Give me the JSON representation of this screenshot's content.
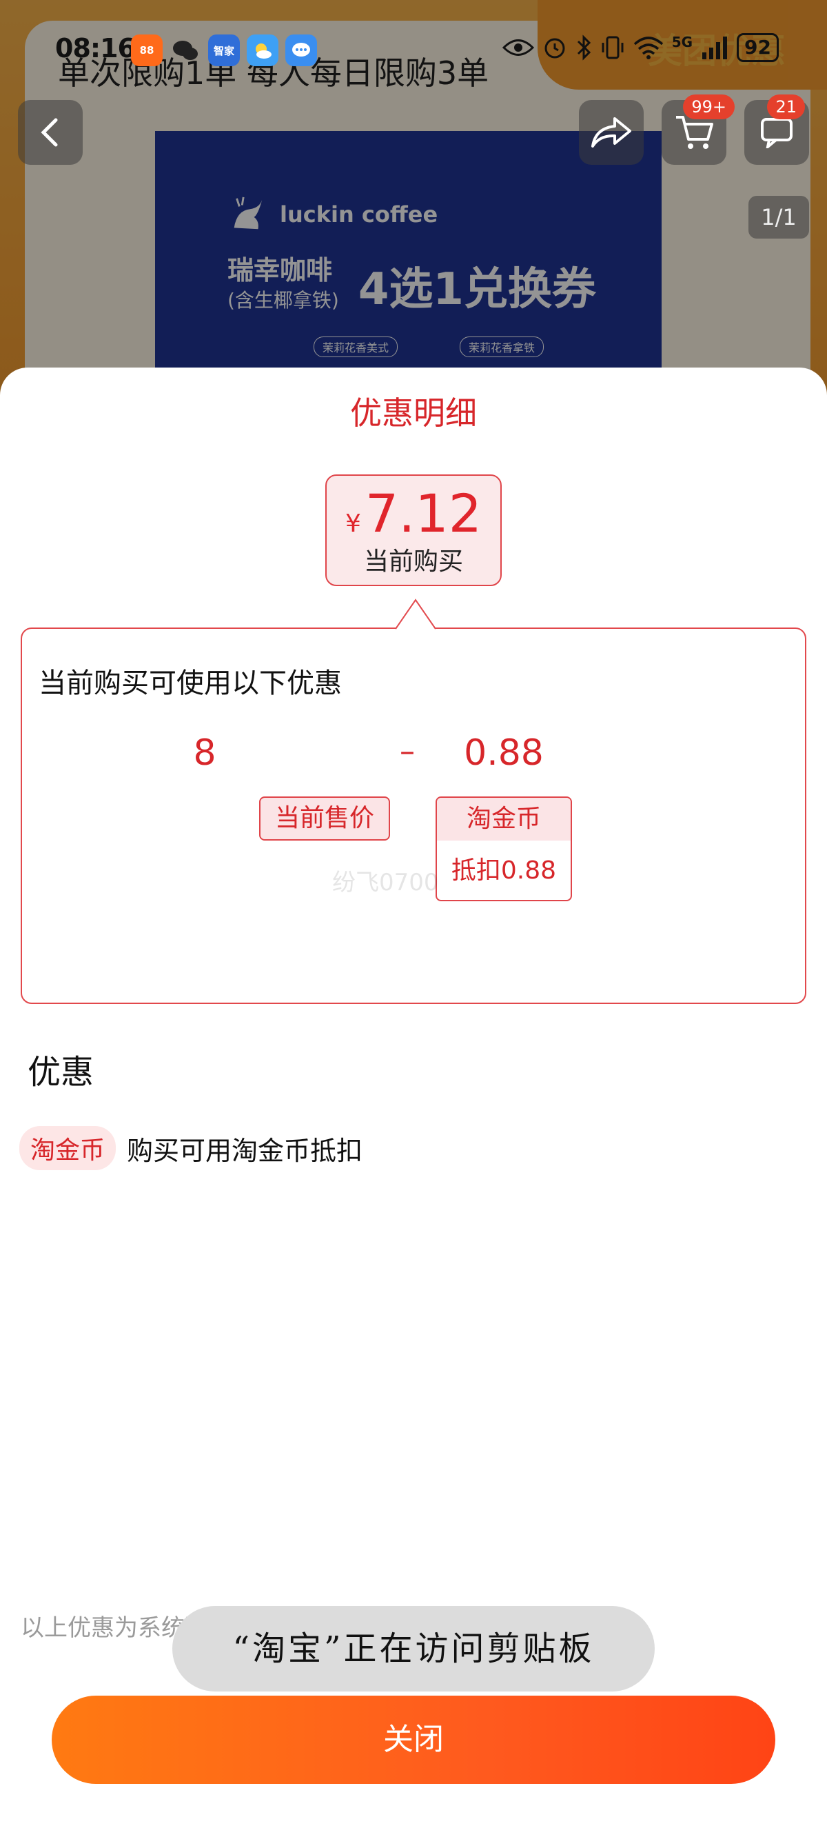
{
  "status_bar": {
    "time": "08:16",
    "app_icons": [
      {
        "name": "shopping-app-icon",
        "label": "88",
        "color": "#ff6a1a"
      },
      {
        "name": "wechat-icon",
        "label": "",
        "color": "#2fb44a"
      },
      {
        "name": "smart-home-icon",
        "label": "智家",
        "color": "#2f6ed8"
      },
      {
        "name": "weather-icon",
        "label": "",
        "color": "#3ea0f5"
      },
      {
        "name": "messages-icon",
        "label": "",
        "color": "#3a8ef0"
      }
    ],
    "network": "5G",
    "battery": "92"
  },
  "background_page": {
    "brand_text": "美团优惠",
    "limit_text": "单次限购1单 每人每日限购3单",
    "poster": {
      "brand": "luckin coffee",
      "title_main": "瑞幸咖啡",
      "title_sub": "(含生椰拿铁)",
      "title_offer": "4选1兑换券",
      "tags": [
        "茉莉花香美式",
        "茉莉花香拿铁"
      ]
    },
    "cart_badge": "99+",
    "msg_badge": "21",
    "pager": "1/1"
  },
  "sheet": {
    "title": "优惠明细",
    "price": {
      "currency": "¥",
      "value": "7.12",
      "label": "当前购买"
    },
    "detail": {
      "heading": "当前购买可使用以下优惠",
      "original_value": "8",
      "operator": "–",
      "discount_value": "0.88",
      "original_label": "当前售价",
      "coin_label": "淘金币",
      "coin_deduct": "抵扣0.88",
      "watermark": "纷飞0700"
    },
    "section_title": "优惠",
    "promo": {
      "tag": "淘金币",
      "text": "购买可用淘金币抵扣"
    },
    "footer_note": "以上优惠为系统预测，仅供参考，以实际为准 详情 >",
    "toast": "“淘宝”正在访问剪贴板",
    "close_label": "关闭"
  },
  "colors": {
    "accent": "#d7262a",
    "button_start": "#ff7a12",
    "button_end": "#ff4415"
  }
}
